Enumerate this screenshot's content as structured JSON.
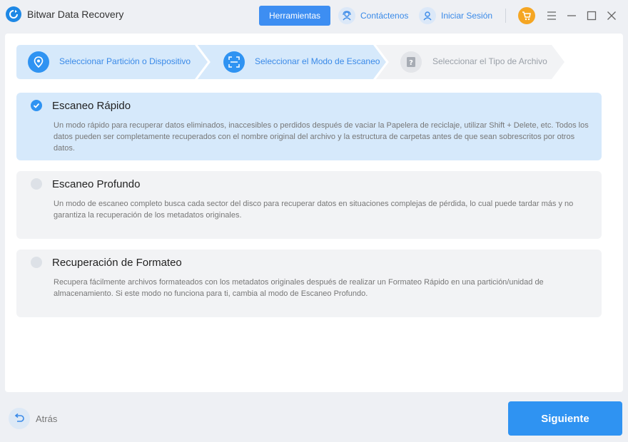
{
  "app": {
    "title": "Bitwar Data Recovery"
  },
  "header": {
    "tools_label": "Herramientas",
    "contact_label": "Contáctenos",
    "login_label": "Iniciar Sesión"
  },
  "steps": [
    {
      "label": "Seleccionar Partición o Dispositivo",
      "state": "done"
    },
    {
      "label": "Seleccionar el Modo de Escaneo",
      "state": "current"
    },
    {
      "label": "Seleccionar el Tipo de Archivo",
      "state": "pending"
    }
  ],
  "scan_modes": [
    {
      "title": "Escaneo Rápido",
      "selected": true,
      "description": "Un modo rápido para recuperar datos eliminados, inaccesibles o perdidos después de vaciar la Papelera de reciclaje, utilizar Shift + Delete, etc. Todos los datos pueden ser completamente recuperados con el nombre original del archivo y la estructura de carpetas antes de que sean sobrescritos por otros datos."
    },
    {
      "title": "Escaneo Profundo",
      "selected": false,
      "description": "Un modo de escaneo completo busca cada sector del disco para recuperar datos en situaciones complejas de pérdida, lo cual puede tardar más y no garantiza la recuperación de los metadatos originales."
    },
    {
      "title": "Recuperación de Formateo",
      "selected": false,
      "description": "Recupera fácilmente archivos formateados con los metadatos originales después de realizar un Formateo Rápido en una partición/unidad de almacenamiento. Si este modo no funciona para ti, cambia al modo de Escaneo Profundo."
    }
  ],
  "footer": {
    "back_label": "Atrás",
    "next_label": "Siguiente"
  },
  "colors": {
    "accent": "#2f93f2",
    "selected_bg": "#d6e9fb",
    "cart": "#f5a623"
  }
}
